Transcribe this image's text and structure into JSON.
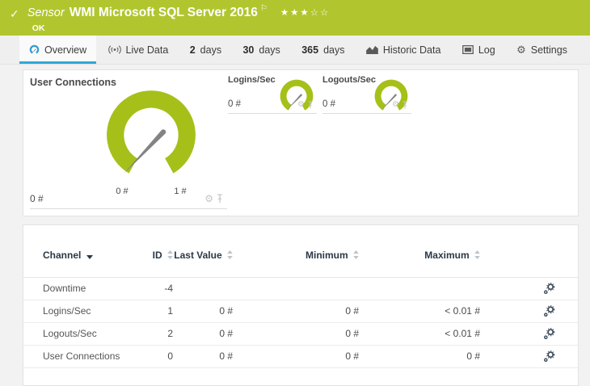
{
  "header": {
    "check": "✓",
    "kind_label": "Sensor",
    "title": "WMI Microsoft SQL Server 2016",
    "flag": "⚐",
    "rating_stars": "★★★☆☆",
    "status": "OK",
    "bar_color": "#b1c62e"
  },
  "tabs": [
    {
      "label": "Overview"
    },
    {
      "label": "Live Data"
    },
    {
      "num": "2",
      "label": "days"
    },
    {
      "num": "30",
      "label": "days"
    },
    {
      "num": "365",
      "label": "days"
    },
    {
      "label": "Historic Data"
    },
    {
      "label": "Log"
    },
    {
      "label": "Settings"
    }
  ],
  "gauges": {
    "accent_color": "#a6c019",
    "primary": {
      "title": "User Connections",
      "value": "0 #",
      "scale_min": "0 #",
      "scale_max": "1 #"
    },
    "secondary": [
      {
        "title": "Logins/Sec",
        "value": "0 #"
      },
      {
        "title": "Logouts/Sec",
        "value": "0 #"
      }
    ]
  },
  "table": {
    "columns": {
      "channel": "Channel",
      "id": "ID",
      "last": "Last Value",
      "min": "Minimum",
      "max": "Maximum"
    },
    "rows": [
      {
        "channel": "Downtime",
        "id": "-4",
        "last": "",
        "min": "",
        "max": ""
      },
      {
        "channel": "Logins/Sec",
        "id": "1",
        "last": "0 #",
        "min": "0 #",
        "max": "< 0.01 #"
      },
      {
        "channel": "Logouts/Sec",
        "id": "2",
        "last": "0 #",
        "min": "0 #",
        "max": "< 0.01 #"
      },
      {
        "channel": "User Connections",
        "id": "0",
        "last": "0 #",
        "min": "0 #",
        "max": "0 #"
      }
    ]
  }
}
